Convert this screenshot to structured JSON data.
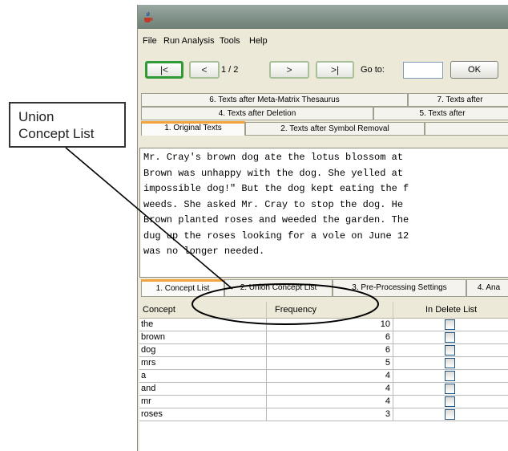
{
  "callout": {
    "line1": "Union",
    "line2": "Concept List"
  },
  "menu": [
    "File",
    "Run Analysis",
    "Tools",
    "Help"
  ],
  "toolbar": {
    "first": "|<",
    "prev": "<",
    "page": "1 / 2",
    "next": ">",
    "last": ">|",
    "goto_label": "Go to:",
    "goto_value": "",
    "ok": "OK"
  },
  "text_tabs": {
    "row1": [
      "6. Texts after Meta-Matrix Thesaurus",
      "7. Texts after"
    ],
    "row2": [
      "4. Texts after Deletion",
      "5. Texts after"
    ],
    "row3": [
      "1. Original Texts",
      "2. Texts after Symbol Removal"
    ]
  },
  "text_lines": [
    "Mr. Cray's brown dog ate the lotus blossom at",
    "Brown was unhappy with the dog. She yelled at",
    "impossible dog!\" But the dog kept eating the f",
    "weeds. She asked Mr. Cray to stop the dog. He",
    "Brown planted roses and weeded the garden. The",
    "dug up the roses looking for a vole on June 12",
    "was no longer needed."
  ],
  "concept_tabs": [
    "1. Concept List",
    "2. Union Concept List",
    "3. Pre-Processing Settings",
    "4. Ana"
  ],
  "table": {
    "headers": [
      "Concept",
      "Frequency",
      "In Delete List"
    ],
    "rows": [
      {
        "concept": "the",
        "frequency": "10",
        "in_delete": false
      },
      {
        "concept": "brown",
        "frequency": "6",
        "in_delete": false
      },
      {
        "concept": "dog",
        "frequency": "6",
        "in_delete": false
      },
      {
        "concept": "mrs",
        "frequency": "5",
        "in_delete": false
      },
      {
        "concept": "a",
        "frequency": "4",
        "in_delete": false
      },
      {
        "concept": "and",
        "frequency": "4",
        "in_delete": false
      },
      {
        "concept": "mr",
        "frequency": "4",
        "in_delete": false
      },
      {
        "concept": "roses",
        "frequency": "3",
        "in_delete": false
      }
    ]
  },
  "colors": {
    "active_tab_accent": "#f2a33c",
    "first_button_border": "#2f9a36",
    "titlebar": "#7e8f86"
  }
}
